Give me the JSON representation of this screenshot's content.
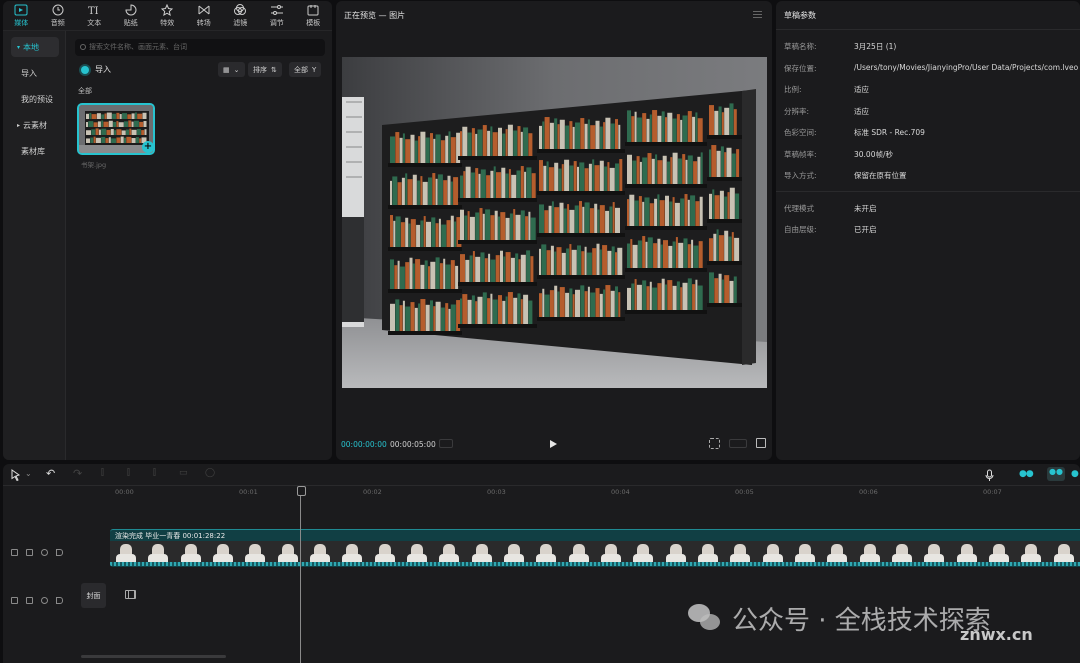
{
  "left_panel": {
    "tabs": [
      {
        "label": "媒体",
        "icon": "media-icon",
        "active": true
      },
      {
        "label": "音频",
        "icon": "audio-icon"
      },
      {
        "label": "文本",
        "icon": "text-icon"
      },
      {
        "label": "贴纸",
        "icon": "sticker-icon"
      },
      {
        "label": "特效",
        "icon": "effects-icon"
      },
      {
        "label": "转场",
        "icon": "transition-icon"
      },
      {
        "label": "滤镜",
        "icon": "filter-icon"
      },
      {
        "label": "调节",
        "icon": "adjust-icon"
      },
      {
        "label": "模板",
        "icon": "template-icon"
      }
    ],
    "nav": [
      "本地",
      "导入",
      "我的预设",
      "云素材",
      "素材库"
    ],
    "search_placeholder": "搜索文件名称、画面元素、台词",
    "import_label": "导入",
    "sort_label": "排序",
    "filter_label": "全部",
    "section_label": "全部",
    "media_file": "书架.jpg"
  },
  "preview": {
    "title": "正在预览 — 图片",
    "current_time": "00:00:00:00",
    "total_time": "00:00:05:00"
  },
  "draft_params": {
    "title": "草稿参数",
    "rows": [
      {
        "k": "草稿名称:",
        "v": "3月25日 (1)"
      },
      {
        "k": "保存位置:",
        "v": "/Users/tony/Movies/JianyingPro/User Data/Projects/com.lveo"
      },
      {
        "k": "比例:",
        "v": "适应"
      },
      {
        "k": "分辨率:",
        "v": "适应"
      },
      {
        "k": "色彩空间:",
        "v": "标准 SDR - Rec.709"
      },
      {
        "k": "草稿帧率:",
        "v": "30.00帧/秒"
      },
      {
        "k": "导入方式:",
        "v": "保留在原有位置"
      },
      {
        "k": "代理模式",
        "v": "未开启"
      },
      {
        "k": "自由层级:",
        "v": "已开启"
      }
    ]
  },
  "timeline": {
    "ticks": [
      "00:00",
      "00:01",
      "00:02",
      "00:03",
      "00:04",
      "00:05",
      "00:06",
      "00:07"
    ],
    "clip_label": "渲染完成  毕业一青春  00:01:28:22",
    "cover_label": "封面"
  },
  "watermark": {
    "text": "公众号 · 全栈技术探索",
    "site": "znwx.cn"
  }
}
